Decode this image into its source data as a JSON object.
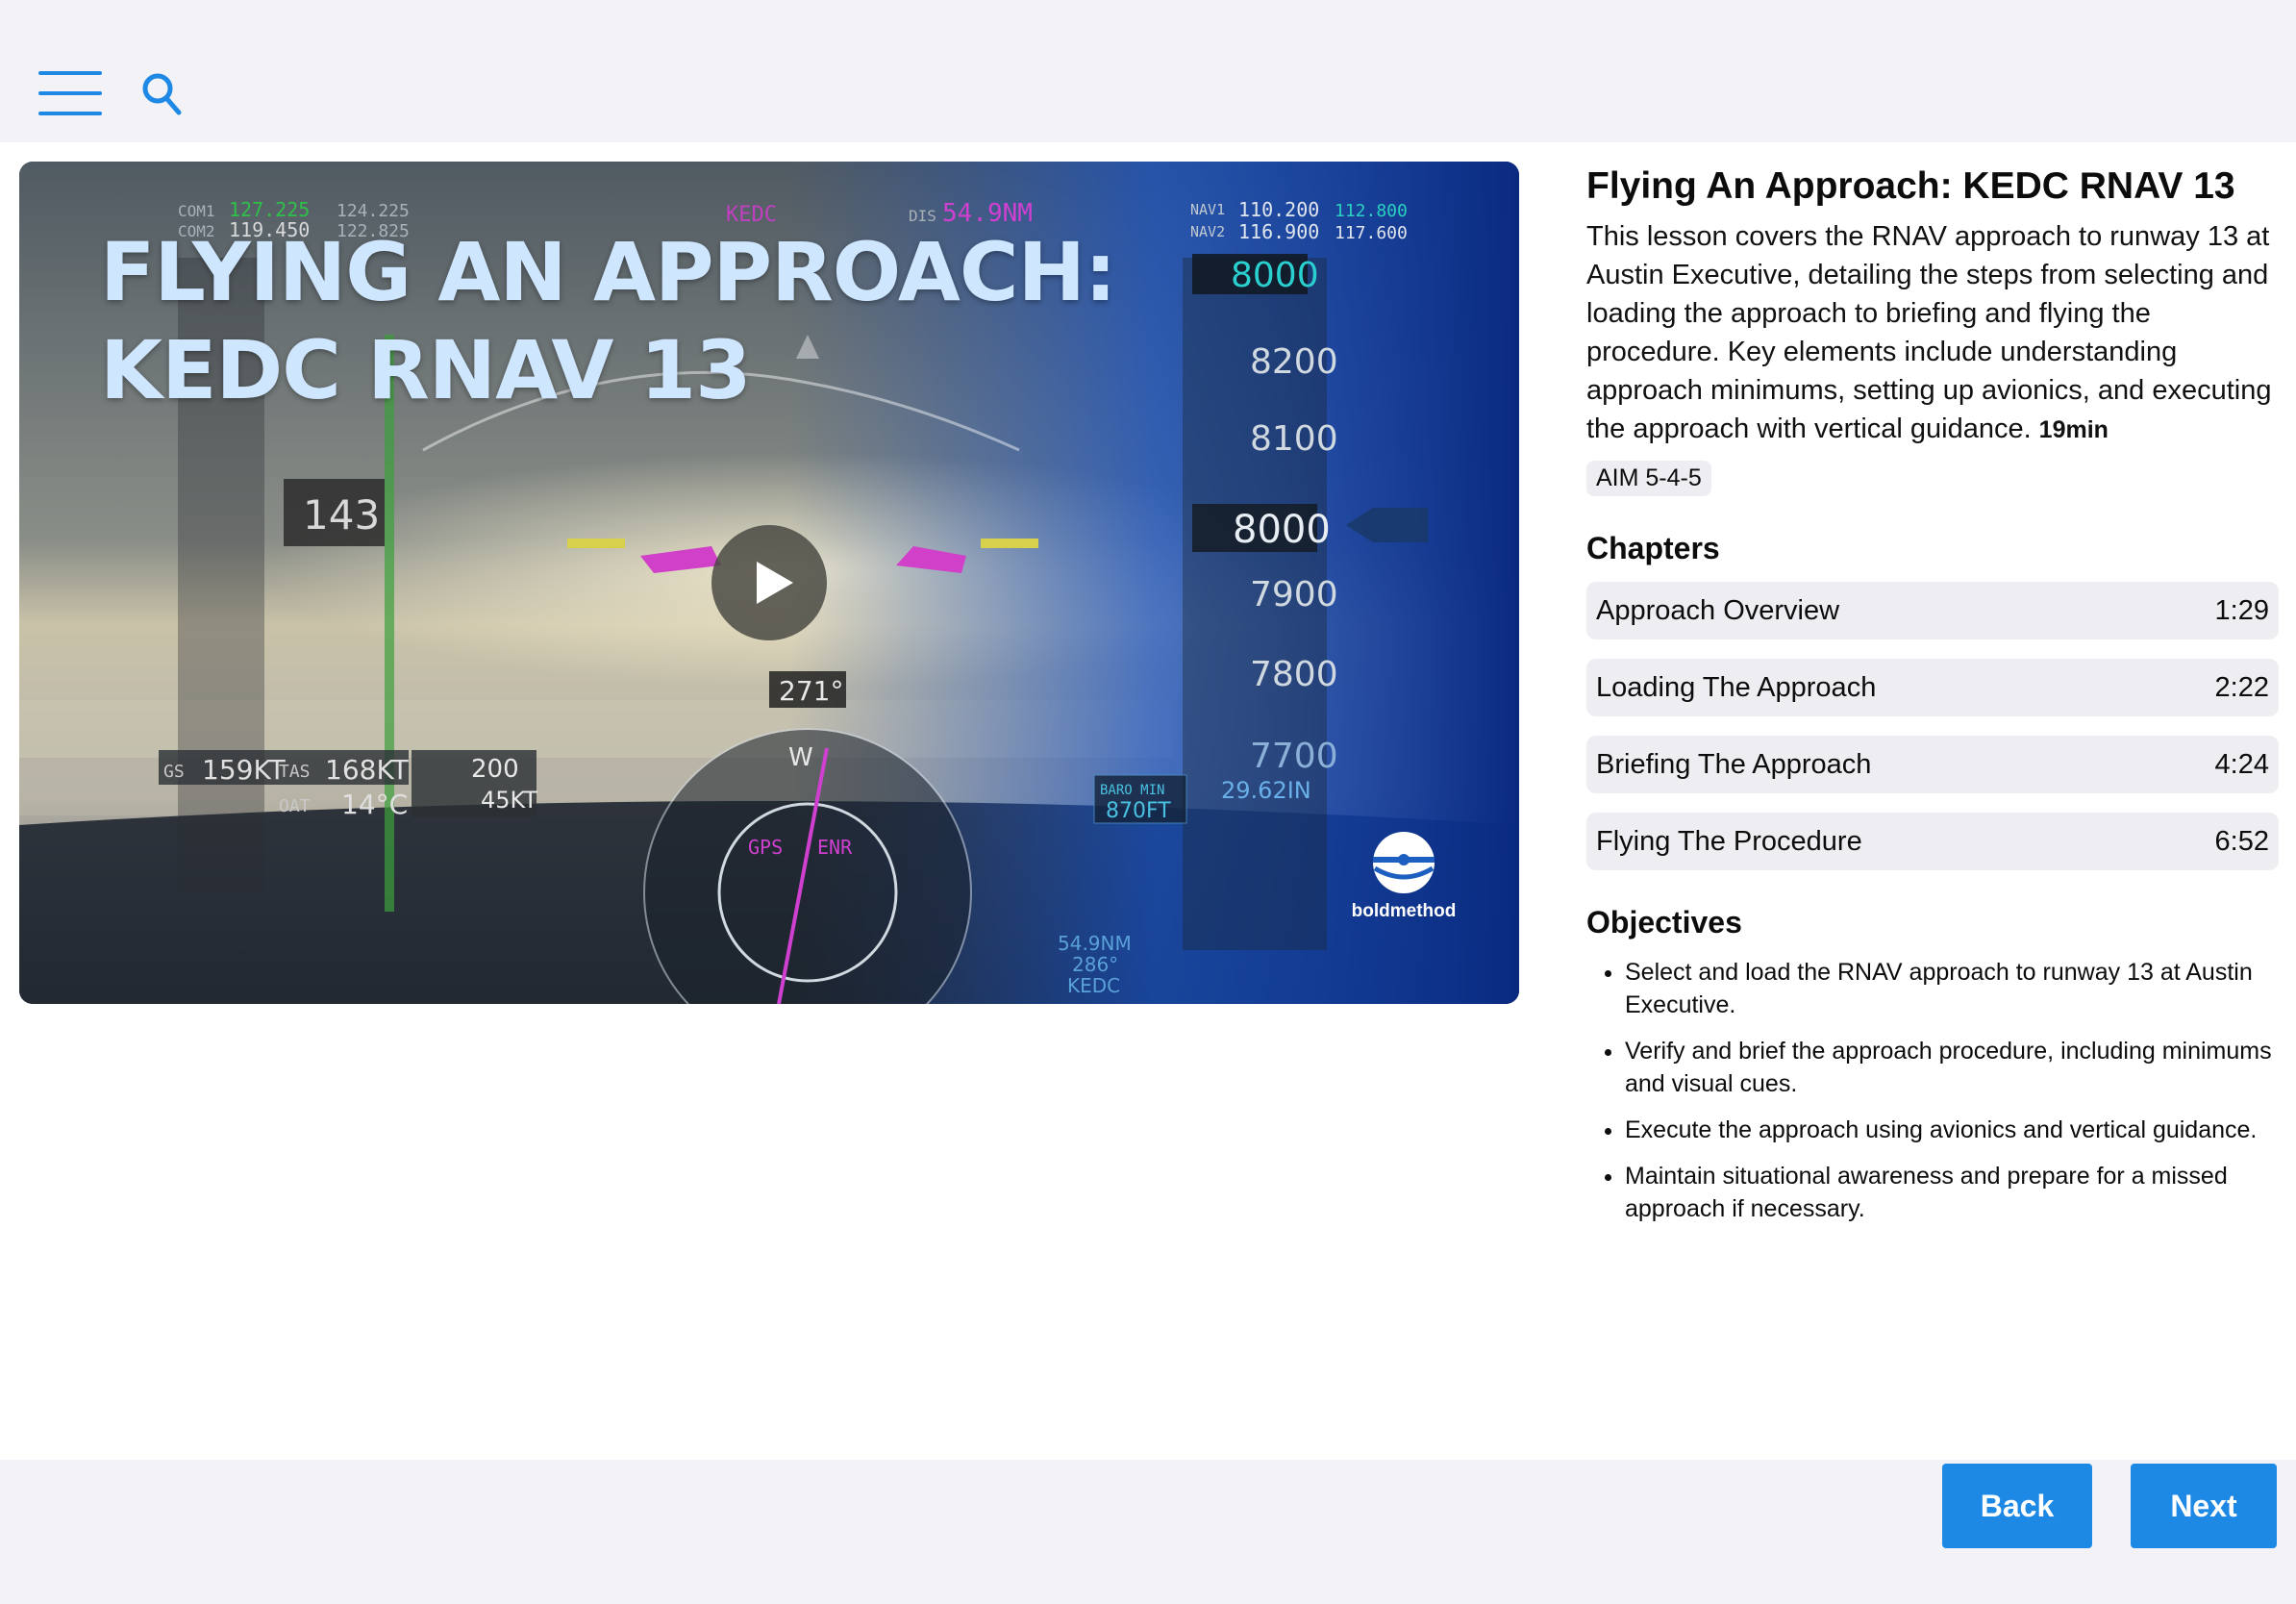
{
  "header": {
    "menu_icon": "hamburger-icon",
    "search_icon": "search-icon"
  },
  "video": {
    "title_line1": "FLYING AN APPROACH:",
    "title_line2": "KEDC RNAV 13",
    "brand": "boldmethod",
    "play_icon": "play-icon",
    "instruments": {
      "com1": "COM1",
      "com1_active": "127.225",
      "com1_standby": "124.225",
      "com2": "COM2",
      "com2_active": "119.450",
      "com2_standby": "122.825",
      "waypoint": "KEDC",
      "dis_label": "DIS",
      "dis_value": "54.9NM",
      "nav1": "NAV1",
      "nav1_active": "110.200",
      "nav1_standby": "112.800",
      "nav2": "NAV2",
      "nav2_active": "116.900",
      "nav2_standby": "117.600",
      "speed_selected": "143",
      "alt_selected": "8000",
      "alt_8200": "8200",
      "alt_8100": "8100",
      "alt_current": "8000",
      "alt_7900": "7900",
      "alt_7800": "7800",
      "alt_7700": "7700",
      "heading": "271°",
      "gs_label": "GS",
      "gs_value": "159KT",
      "tas_label": "TAS",
      "tas_value": "168KT",
      "oat_label": "OAT",
      "oat_value": "14°C",
      "wind_dir": "200",
      "wind_speed": "45KT",
      "baro_label": "BARO MIN",
      "baro_value": "870FT",
      "altimeter": "29.62IN",
      "gps_label": "GPS",
      "enr_label": "ENR",
      "bottom_dist": "54.9NM",
      "bottom_crs": "286°",
      "bottom_wpt": "KEDC"
    }
  },
  "lesson": {
    "title": "Flying An Approach: KEDC RNAV 13",
    "description": "This lesson covers the RNAV approach to runway 13 at Austin Executive, detailing the steps from selecting and loading the approach to briefing and flying the procedure. Key elements include understanding approach minimums, setting up avionics, and executing the approach with vertical guidance.",
    "duration": "19min",
    "reference": "AIM 5-4-5"
  },
  "chapters": {
    "heading": "Chapters",
    "items": [
      {
        "title": "Approach Overview",
        "time": "1:29"
      },
      {
        "title": "Loading The Approach",
        "time": "2:22"
      },
      {
        "title": "Briefing The Approach",
        "time": "4:24"
      },
      {
        "title": "Flying The Procedure",
        "time": "6:52"
      }
    ]
  },
  "objectives": {
    "heading": "Objectives",
    "items": [
      "Select and load the RNAV approach to runway 13 at Austin Executive.",
      "Verify and brief the approach procedure, including minimums and visual cues.",
      "Execute the approach using avionics and vertical guidance.",
      "Maintain situational awareness and prepare for a missed approach if necessary."
    ]
  },
  "footer": {
    "back_label": "Back",
    "next_label": "Next"
  },
  "colors": {
    "accent": "#1e88e5",
    "chip_bg": "#eeeef2",
    "bar_bg": "#f3f3f7"
  }
}
